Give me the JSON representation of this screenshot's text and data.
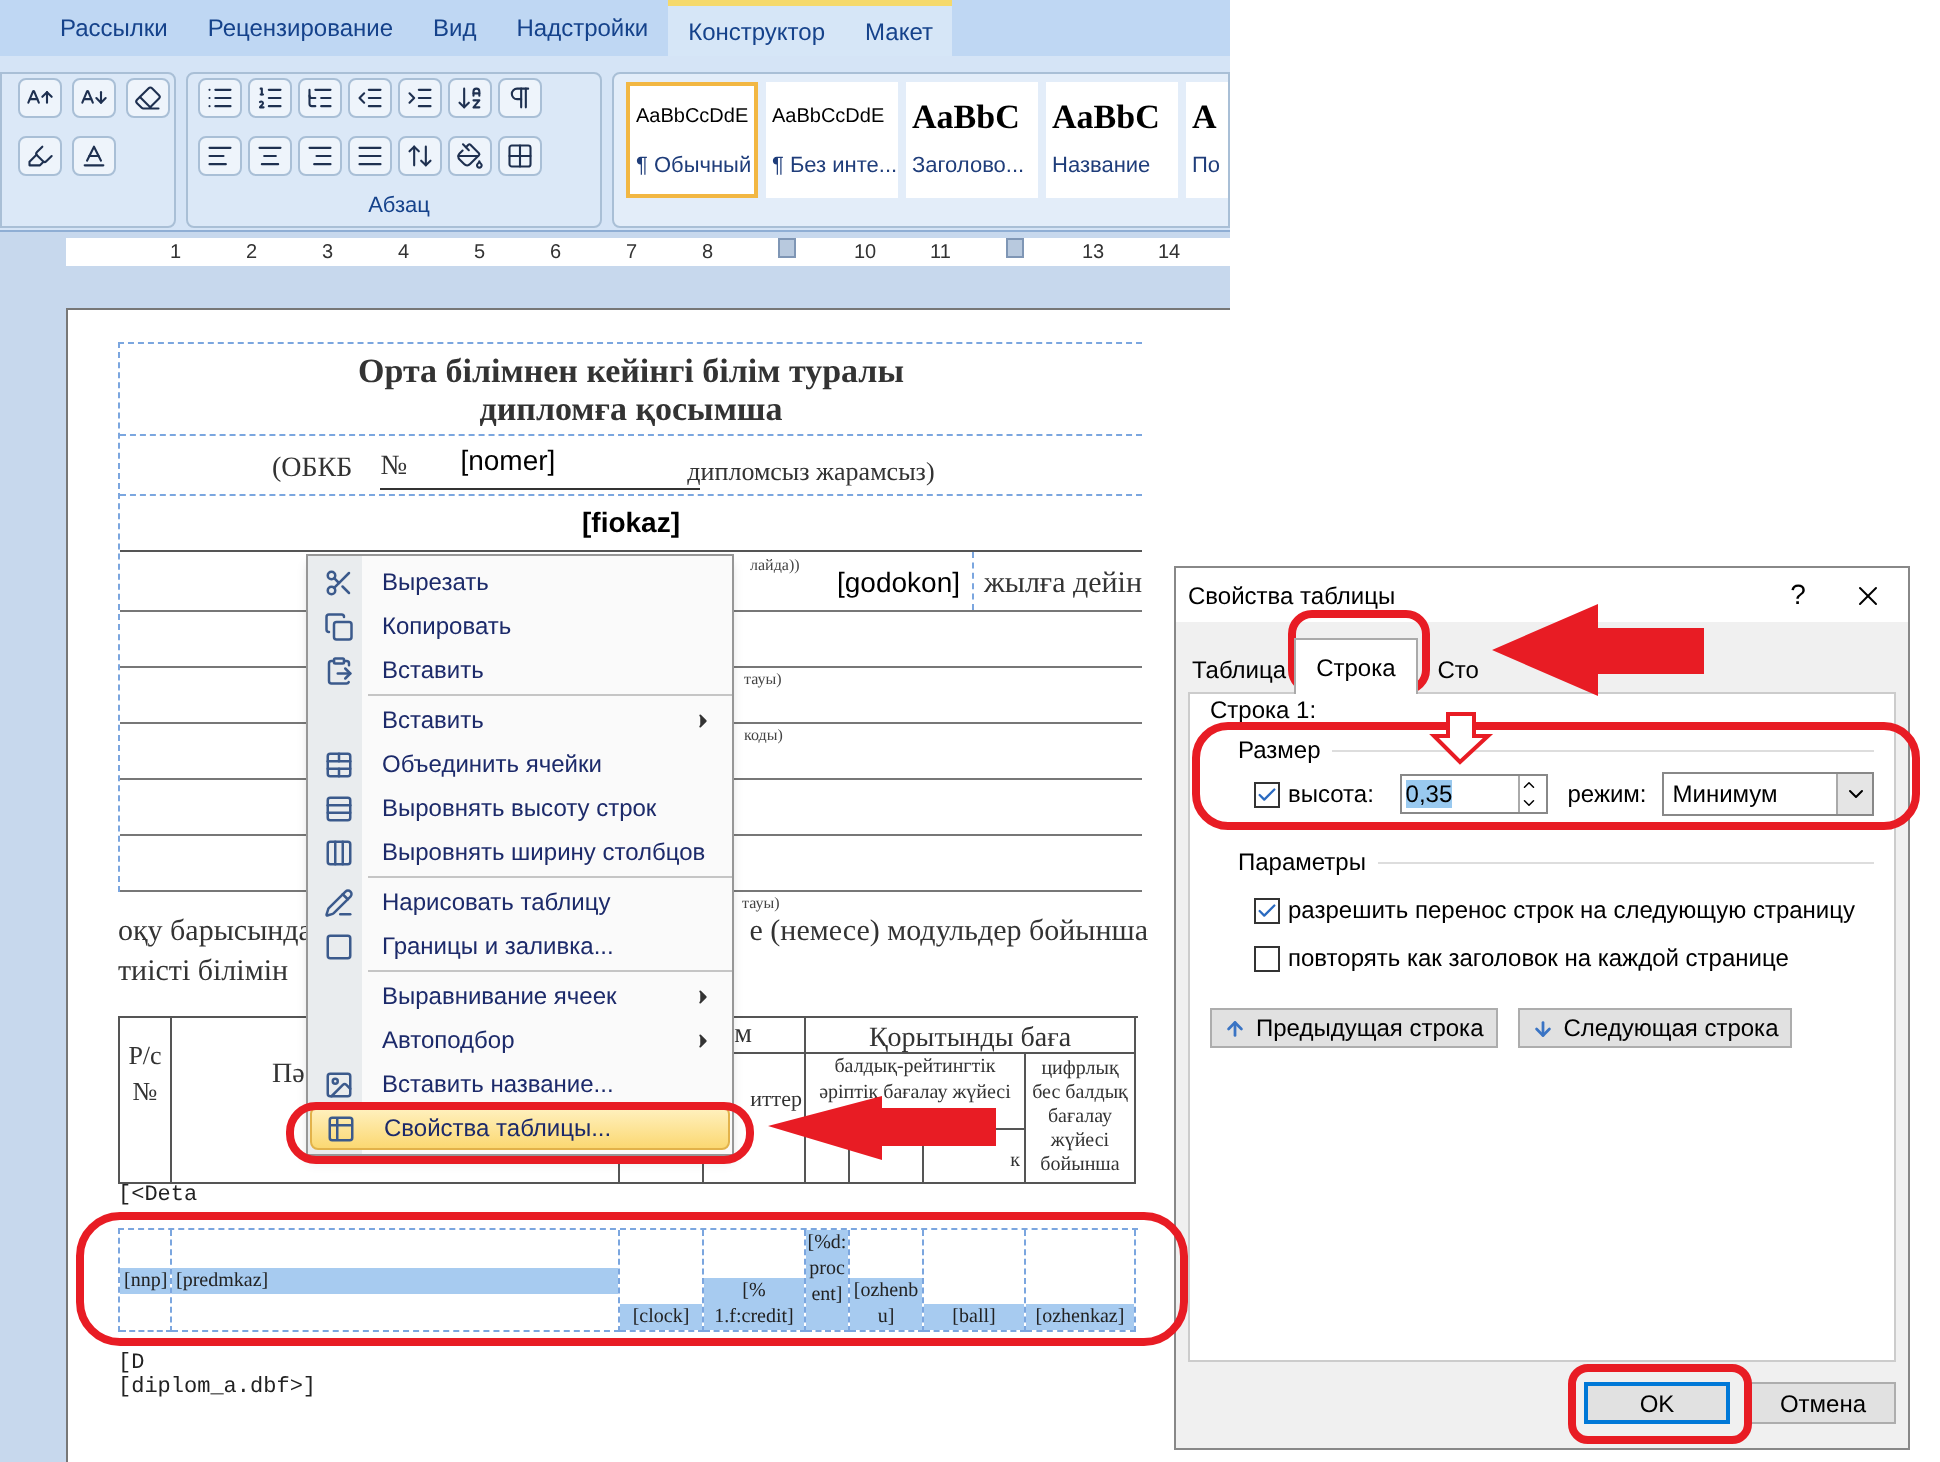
{
  "ribbon": {
    "tabs": [
      {
        "label": "Рассылки",
        "contextual": false
      },
      {
        "label": "Рецензирование",
        "contextual": false
      },
      {
        "label": "Вид",
        "contextual": false
      },
      {
        "label": "Надстройки",
        "contextual": false
      },
      {
        "label": "Конструктор",
        "contextual": true
      },
      {
        "label": "Макет",
        "contextual": true
      }
    ],
    "group_label": "Абзац",
    "styles": [
      {
        "sample": "AaBbCcDdE",
        "name": "¶ Обычный",
        "selected": true,
        "kind": "body"
      },
      {
        "sample": "AaBbCcDdE",
        "name": "¶ Без инте...",
        "selected": false,
        "kind": "body"
      },
      {
        "sample": "AaBbC",
        "name": "Заголово...",
        "selected": false,
        "kind": "heading"
      },
      {
        "sample": "AaBbC",
        "name": "Название",
        "selected": false,
        "kind": "heading"
      },
      {
        "sample": "A",
        "name": "По",
        "selected": false,
        "kind": "heading"
      }
    ]
  },
  "ruler": [
    {
      "kind": "number",
      "label": "1"
    },
    {
      "kind": "number",
      "label": "2"
    },
    {
      "kind": "number",
      "label": "3"
    },
    {
      "kind": "number",
      "label": "4"
    },
    {
      "kind": "number",
      "label": "5"
    },
    {
      "kind": "number",
      "label": "6"
    },
    {
      "kind": "number",
      "label": "7"
    },
    {
      "kind": "number",
      "label": "8"
    },
    {
      "kind": "marker"
    },
    {
      "kind": "number",
      "label": "10"
    },
    {
      "kind": "number",
      "label": "11"
    },
    {
      "kind": "marker"
    },
    {
      "kind": "number",
      "label": "13"
    },
    {
      "kind": "number",
      "label": "14"
    }
  ],
  "document": {
    "title_lines": [
      "Орта білімнен кейінгі білім туралы",
      "дипломға қосымша"
    ],
    "obkb": "(ОБКБ",
    "number_sign": "№",
    "nomer": "[nomer]",
    "validity": "дипломсыз жарамсыз)",
    "fiokaz": "[fiokaz]",
    "godokon_hint": "лайда))",
    "godokon": "[godokon]",
    "until": "жылға дейін",
    "row_hints": [
      "тауы)",
      "коды)"
    ],
    "bottom_hint": "тауы)",
    "para_left": "оқу барысында",
    "para_right": "е (немесе) модульдер бойынша",
    "para_line2": "тиісті білімін",
    "table": {
      "col_number": "Р/с №",
      "col_subject": "Пә",
      "col_hours": "м",
      "col_credits": "иттер",
      "col_final": "Қорытынды баға",
      "col_letter": "балдық-рейтингтік әріптік бағалау жүйесі",
      "col_letter_sub": "к",
      "col_digit": "цифрлық бес балдық бағалау жүйесі бойынша",
      "row": [
        "[nnp]",
        "[predmkaz]",
        "[clock]",
        "[% 1.f:credit]",
        "[%d:procent]",
        "[ozhenbu]",
        "[ball]",
        "[ozhenkaz]"
      ]
    },
    "detail_start": "[<Deta",
    "detail_end": "[D",
    "source": "[diplom_a.dbf>]"
  },
  "context_menu": [
    {
      "kind": "item",
      "label": "Вырезать",
      "submenu": false,
      "selected": false
    },
    {
      "kind": "item",
      "label": "Копировать",
      "submenu": false,
      "selected": false
    },
    {
      "kind": "item",
      "label": "Вставить",
      "submenu": false,
      "selected": false
    },
    {
      "kind": "separator"
    },
    {
      "kind": "item",
      "label": "Вставить",
      "submenu": true,
      "selected": false
    },
    {
      "kind": "item",
      "label": "Объединить ячейки",
      "submenu": false,
      "selected": false
    },
    {
      "kind": "item",
      "label": "Выровнять высоту строк",
      "submenu": false,
      "selected": false
    },
    {
      "kind": "item",
      "label": "Выровнять ширину столбцов",
      "submenu": false,
      "selected": false
    },
    {
      "kind": "separator"
    },
    {
      "kind": "item",
      "label": "Нарисовать таблицу",
      "submenu": false,
      "selected": false
    },
    {
      "kind": "item",
      "label": "Границы и заливка...",
      "submenu": false,
      "selected": false
    },
    {
      "kind": "separator"
    },
    {
      "kind": "item",
      "label": "Выравнивание ячеек",
      "submenu": true,
      "selected": false
    },
    {
      "kind": "item",
      "label": "Автоподбор",
      "submenu": true,
      "selected": false
    },
    {
      "kind": "item",
      "label": "Вставить название...",
      "submenu": false,
      "selected": false
    },
    {
      "kind": "item",
      "label": "Свойства таблицы...",
      "submenu": false,
      "selected": true
    }
  ],
  "dialog": {
    "title": "Свойства таблицы",
    "help": "?",
    "tabs": [
      {
        "label": "Таблица",
        "selected": false
      },
      {
        "label": "Строка",
        "selected": true
      },
      {
        "label": "Сто",
        "selected": false
      }
    ],
    "row_label": "Строка 1:",
    "size_group": "Размер",
    "height": {
      "label": "высота:",
      "checked": true,
      "value": "0,35"
    },
    "mode": {
      "label": "режим:",
      "value": "Минимум"
    },
    "params_group": "Параметры",
    "options": [
      {
        "label": "разрешить перенос строк на следующую страницу",
        "checked": true
      },
      {
        "label": "повторять как заголовок на каждой странице",
        "checked": false
      }
    ],
    "nav_buttons": [
      {
        "label": "Предыдущая строка",
        "kind": "prev"
      },
      {
        "label": "Следующая строка",
        "kind": "next"
      }
    ],
    "buttons": [
      {
        "label": "OK",
        "default": true
      },
      {
        "label": "Отмена",
        "default": false
      }
    ]
  }
}
